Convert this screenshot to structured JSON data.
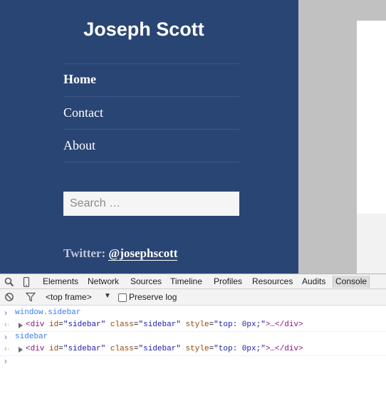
{
  "site": {
    "title": "Joseph Scott",
    "nav": [
      {
        "label": "Home"
      },
      {
        "label": "Contact"
      },
      {
        "label": "About"
      }
    ],
    "search_placeholder": "Search …",
    "twitter_label": "Twitter:",
    "twitter_handle": "@josephscott"
  },
  "devtools": {
    "tabs": [
      "Elements",
      "Network",
      "Sources",
      "Timeline",
      "Profiles",
      "Resources",
      "Audits",
      "Console"
    ],
    "selected_tab": "Console",
    "frame_selector": "<top frame>",
    "preserve_log_label": "Preserve log",
    "preserve_log_checked": false,
    "console": [
      {
        "command": "window.sidebar",
        "result": {
          "tag_open": "<div",
          "attrs": [
            [
              "id",
              "sidebar"
            ],
            [
              "class",
              "sidebar"
            ],
            [
              "style",
              "top: 0px;"
            ]
          ],
          "tail": ">…</div>"
        }
      },
      {
        "command": "sidebar",
        "result": {
          "tag_open": "<div",
          "attrs": [
            [
              "id",
              "sidebar"
            ],
            [
              "class",
              "sidebar"
            ],
            [
              "style",
              "top: 0px;"
            ]
          ],
          "tail": ">…</div>"
        }
      }
    ],
    "prompt_symbol": "›",
    "return_symbol": "‹·"
  },
  "colors": {
    "sidebar_bg": "#294574",
    "page_gray": "#c1c1c1",
    "console_blue": "#367cf1",
    "tag_purple": "#881280",
    "attr_name": "#994500",
    "attr_value": "#1a1aa6"
  },
  "icons": {
    "inspect": "search-icon",
    "device": "mobile-device-icon",
    "clear": "clear-console-icon",
    "filter": "filter-icon"
  }
}
